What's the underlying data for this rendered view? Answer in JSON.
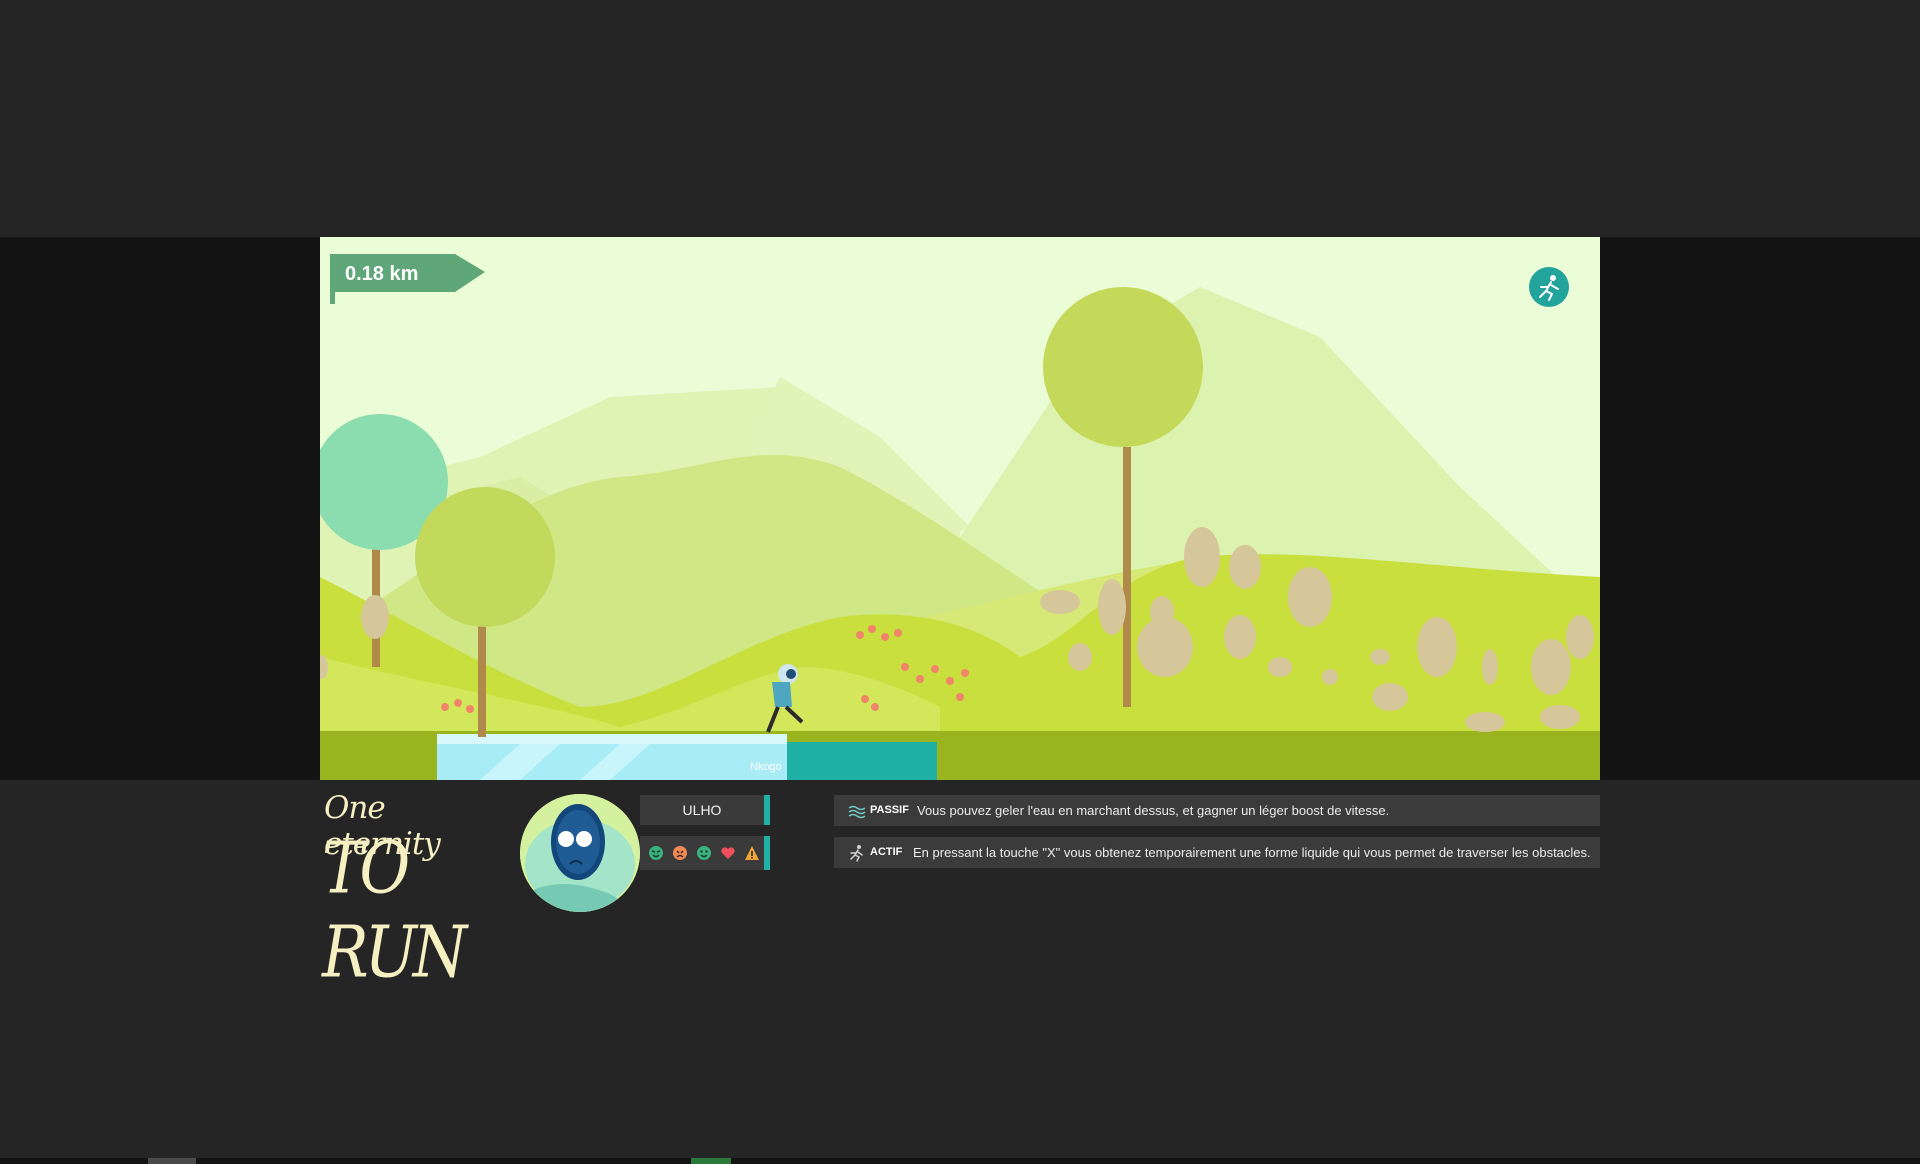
{
  "hud": {
    "distance": "0.18 km",
    "player_tag": "Nkogo"
  },
  "logo": {
    "line1": "One eternity",
    "line2": "TO RUN"
  },
  "character": {
    "name": "ULHO",
    "status_icons": [
      "emotion-happy-icon",
      "emotion-angry-icon",
      "emotion-smile-icon",
      "heart-icon",
      "warning-icon"
    ]
  },
  "abilities": {
    "passive": {
      "kind": "PASSIF",
      "icon": "waves-icon",
      "text": "Vous pouvez geler l'eau en marchant dessus, et gagner un léger boost de vitesse."
    },
    "active": {
      "kind": "ACTIF",
      "icon": "runner-icon",
      "text": "En pressant la touche \"X\" vous obtenez temporairement une forme liquide qui vous permet de traverser les obstacles."
    }
  },
  "colors": {
    "accent": "#1fb1a5",
    "flag": "#5fa779",
    "sky": "#eafdd6",
    "ground": "#9ab41f"
  }
}
